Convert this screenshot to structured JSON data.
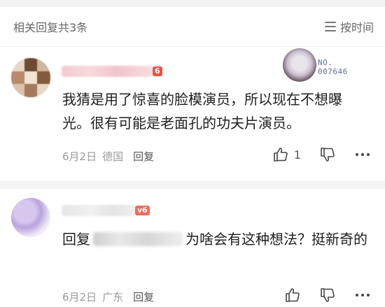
{
  "header": {
    "title": "相关回复共3条",
    "sort_label": "按时间"
  },
  "medal": {
    "text": "NO.\n007646"
  },
  "comments": [
    {
      "level": "6",
      "content": "我猜是用了惊喜的脸模演员，所以现在不想曝光。很有可能是老面孔的功夫片演员。",
      "date": "6月2日",
      "location": "德国",
      "reply_label": "回复",
      "like_count": "1"
    },
    {
      "level": "v6",
      "reply_prefix": "回复",
      "content_after": "为啥会有这种想法？挺新奇的",
      "date": "6月2日",
      "location": "广东",
      "reply_label": "回复"
    }
  ],
  "icons": {
    "sort": "list-sort-icon",
    "like": "thumbs-up-icon",
    "dislike": "thumbs-down-icon",
    "more": "more-dots-icon"
  }
}
